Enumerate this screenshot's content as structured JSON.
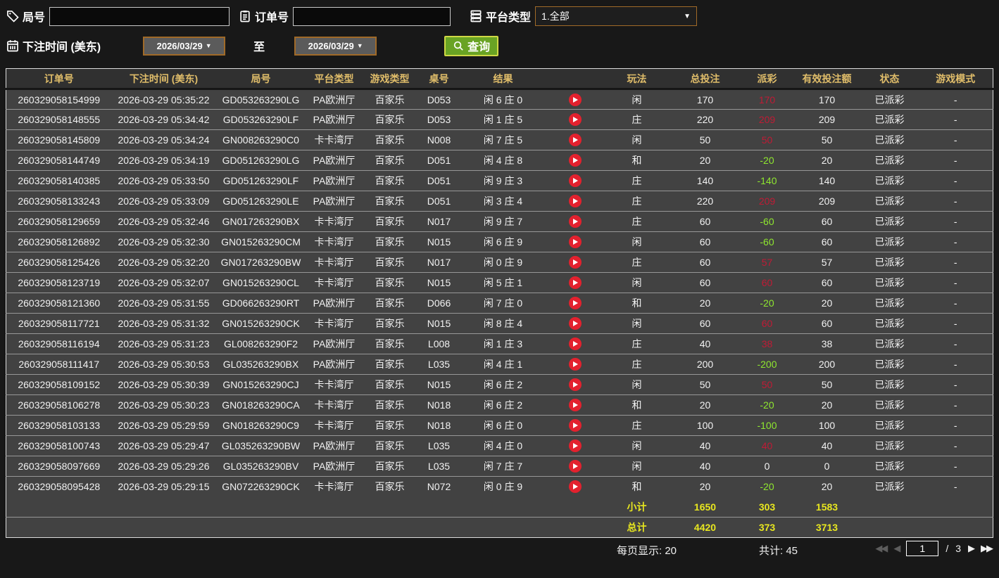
{
  "colors": {
    "header_gold": "#e0bd6a",
    "payout_positive_red": "#c01b35",
    "payout_negative_green": "#8fe72f",
    "status_green": "#35d13f",
    "summary_yellow": "#e8e71f",
    "search_button_green": "#69a324",
    "search_button_border": "#cfd945",
    "date_border_orange": "#a06a28",
    "row_bg": "#424242",
    "play_button_red": "#e3212e"
  },
  "icons": {
    "dropdown": "▼",
    "first_page": "◀◀",
    "prev_page": "◀",
    "next_page": "▶",
    "last_page": "▶▶"
  },
  "filters": {
    "game_no_label": "局号",
    "game_no_value": "",
    "order_no_label": "订单号",
    "order_no_value": "",
    "platform_label": "平台类型",
    "platform_value": "1.全部",
    "bet_time_label": "下注时间 (美东)",
    "date_from": "2026/03/29",
    "to_separator": "至",
    "date_to": "2026/03/29",
    "search_label": "查询"
  },
  "table": {
    "columns": [
      "订单号",
      "下注时间 (美东)",
      "局号",
      "平台类型",
      "游戏类型",
      "桌号",
      "结果",
      "",
      "玩法",
      "总投注",
      "派彩",
      "有效投注额",
      "状态",
      "游戏模式"
    ],
    "rows": [
      {
        "order_no": "260329058154999",
        "bet_time": "2026-03-29 05:35:22",
        "round_no": "GD053263290LG",
        "platform": "PA欧洲厅",
        "game_type": "百家乐",
        "table_no": "D053",
        "result": "闲 6 庄 0",
        "play_type": "闲",
        "total_bet": "170",
        "payout": "170",
        "valid_bet": "170",
        "status": "已派彩",
        "mode": "-"
      },
      {
        "order_no": "260329058148555",
        "bet_time": "2026-03-29 05:34:42",
        "round_no": "GD053263290LF",
        "platform": "PA欧洲厅",
        "game_type": "百家乐",
        "table_no": "D053",
        "result": "闲 1 庄 5",
        "play_type": "庄",
        "total_bet": "220",
        "payout": "209",
        "valid_bet": "209",
        "status": "已派彩",
        "mode": "-"
      },
      {
        "order_no": "260329058145809",
        "bet_time": "2026-03-29 05:34:24",
        "round_no": "GN008263290C0",
        "platform": "卡卡湾厅",
        "game_type": "百家乐",
        "table_no": "N008",
        "result": "闲 7 庄 5",
        "play_type": "闲",
        "total_bet": "50",
        "payout": "50",
        "valid_bet": "50",
        "status": "已派彩",
        "mode": "-"
      },
      {
        "order_no": "260329058144749",
        "bet_time": "2026-03-29 05:34:19",
        "round_no": "GD051263290LG",
        "platform": "PA欧洲厅",
        "game_type": "百家乐",
        "table_no": "D051",
        "result": "闲 4 庄 8",
        "play_type": "和",
        "total_bet": "20",
        "payout": "-20",
        "valid_bet": "20",
        "status": "已派彩",
        "mode": "-"
      },
      {
        "order_no": "260329058140385",
        "bet_time": "2026-03-29 05:33:50",
        "round_no": "GD051263290LF",
        "platform": "PA欧洲厅",
        "game_type": "百家乐",
        "table_no": "D051",
        "result": "闲 9 庄 3",
        "play_type": "庄",
        "total_bet": "140",
        "payout": "-140",
        "valid_bet": "140",
        "status": "已派彩",
        "mode": "-"
      },
      {
        "order_no": "260329058133243",
        "bet_time": "2026-03-29 05:33:09",
        "round_no": "GD051263290LE",
        "platform": "PA欧洲厅",
        "game_type": "百家乐",
        "table_no": "D051",
        "result": "闲 3 庄 4",
        "play_type": "庄",
        "total_bet": "220",
        "payout": "209",
        "valid_bet": "209",
        "status": "已派彩",
        "mode": "-"
      },
      {
        "order_no": "260329058129659",
        "bet_time": "2026-03-29 05:32:46",
        "round_no": "GN017263290BX",
        "platform": "卡卡湾厅",
        "game_type": "百家乐",
        "table_no": "N017",
        "result": "闲 9 庄 7",
        "play_type": "庄",
        "total_bet": "60",
        "payout": "-60",
        "valid_bet": "60",
        "status": "已派彩",
        "mode": "-"
      },
      {
        "order_no": "260329058126892",
        "bet_time": "2026-03-29 05:32:30",
        "round_no": "GN015263290CM",
        "platform": "卡卡湾厅",
        "game_type": "百家乐",
        "table_no": "N015",
        "result": "闲 6 庄 9",
        "play_type": "闲",
        "total_bet": "60",
        "payout": "-60",
        "valid_bet": "60",
        "status": "已派彩",
        "mode": "-"
      },
      {
        "order_no": "260329058125426",
        "bet_time": "2026-03-29 05:32:20",
        "round_no": "GN017263290BW",
        "platform": "卡卡湾厅",
        "game_type": "百家乐",
        "table_no": "N017",
        "result": "闲 0 庄 9",
        "play_type": "庄",
        "total_bet": "60",
        "payout": "57",
        "valid_bet": "57",
        "status": "已派彩",
        "mode": "-"
      },
      {
        "order_no": "260329058123719",
        "bet_time": "2026-03-29 05:32:07",
        "round_no": "GN015263290CL",
        "platform": "卡卡湾厅",
        "game_type": "百家乐",
        "table_no": "N015",
        "result": "闲 5 庄 1",
        "play_type": "闲",
        "total_bet": "60",
        "payout": "60",
        "valid_bet": "60",
        "status": "已派彩",
        "mode": "-"
      },
      {
        "order_no": "260329058121360",
        "bet_time": "2026-03-29 05:31:55",
        "round_no": "GD066263290RT",
        "platform": "PA欧洲厅",
        "game_type": "百家乐",
        "table_no": "D066",
        "result": "闲 7 庄 0",
        "play_type": "和",
        "total_bet": "20",
        "payout": "-20",
        "valid_bet": "20",
        "status": "已派彩",
        "mode": "-"
      },
      {
        "order_no": "260329058117721",
        "bet_time": "2026-03-29 05:31:32",
        "round_no": "GN015263290CK",
        "platform": "卡卡湾厅",
        "game_type": "百家乐",
        "table_no": "N015",
        "result": "闲 8 庄 4",
        "play_type": "闲",
        "total_bet": "60",
        "payout": "60",
        "valid_bet": "60",
        "status": "已派彩",
        "mode": "-"
      },
      {
        "order_no": "260329058116194",
        "bet_time": "2026-03-29 05:31:23",
        "round_no": "GL008263290F2",
        "platform": "PA欧洲厅",
        "game_type": "百家乐",
        "table_no": "L008",
        "result": "闲 1 庄 3",
        "play_type": "庄",
        "total_bet": "40",
        "payout": "38",
        "valid_bet": "38",
        "status": "已派彩",
        "mode": "-"
      },
      {
        "order_no": "260329058111417",
        "bet_time": "2026-03-29 05:30:53",
        "round_no": "GL035263290BX",
        "platform": "PA欧洲厅",
        "game_type": "百家乐",
        "table_no": "L035",
        "result": "闲 4 庄 1",
        "play_type": "庄",
        "total_bet": "200",
        "payout": "-200",
        "valid_bet": "200",
        "status": "已派彩",
        "mode": "-"
      },
      {
        "order_no": "260329058109152",
        "bet_time": "2026-03-29 05:30:39",
        "round_no": "GN015263290CJ",
        "platform": "卡卡湾厅",
        "game_type": "百家乐",
        "table_no": "N015",
        "result": "闲 6 庄 2",
        "play_type": "闲",
        "total_bet": "50",
        "payout": "50",
        "valid_bet": "50",
        "status": "已派彩",
        "mode": "-"
      },
      {
        "order_no": "260329058106278",
        "bet_time": "2026-03-29 05:30:23",
        "round_no": "GN018263290CA",
        "platform": "卡卡湾厅",
        "game_type": "百家乐",
        "table_no": "N018",
        "result": "闲 6 庄 2",
        "play_type": "和",
        "total_bet": "20",
        "payout": "-20",
        "valid_bet": "20",
        "status": "已派彩",
        "mode": "-"
      },
      {
        "order_no": "260329058103133",
        "bet_time": "2026-03-29 05:29:59",
        "round_no": "GN018263290C9",
        "platform": "卡卡湾厅",
        "game_type": "百家乐",
        "table_no": "N018",
        "result": "闲 6 庄 0",
        "play_type": "庄",
        "total_bet": "100",
        "payout": "-100",
        "valid_bet": "100",
        "status": "已派彩",
        "mode": "-"
      },
      {
        "order_no": "260329058100743",
        "bet_time": "2026-03-29 05:29:47",
        "round_no": "GL035263290BW",
        "platform": "PA欧洲厅",
        "game_type": "百家乐",
        "table_no": "L035",
        "result": "闲 4 庄 0",
        "play_type": "闲",
        "total_bet": "40",
        "payout": "40",
        "valid_bet": "40",
        "status": "已派彩",
        "mode": "-"
      },
      {
        "order_no": "260329058097669",
        "bet_time": "2026-03-29 05:29:26",
        "round_no": "GL035263290BV",
        "platform": "PA欧洲厅",
        "game_type": "百家乐",
        "table_no": "L035",
        "result": "闲 7 庄 7",
        "play_type": "闲",
        "total_bet": "40",
        "payout": "0",
        "valid_bet": "0",
        "status": "已派彩",
        "mode": "-"
      },
      {
        "order_no": "260329058095428",
        "bet_time": "2026-03-29 05:29:15",
        "round_no": "GN072263290CK",
        "platform": "卡卡湾厅",
        "game_type": "百家乐",
        "table_no": "N072",
        "result": "闲 0 庄 9",
        "play_type": "和",
        "total_bet": "20",
        "payout": "-20",
        "valid_bet": "20",
        "status": "已派彩",
        "mode": "-"
      }
    ],
    "subtotal": {
      "label": "小计",
      "total_bet": "1650",
      "payout": "303",
      "valid_bet": "1583"
    },
    "total": {
      "label": "总计",
      "total_bet": "4420",
      "payout": "373",
      "valid_bet": "3713"
    }
  },
  "footer": {
    "per_page_label": "每页显示: 20",
    "total_count_label": "共计: 45",
    "current_page": "1",
    "page_separator": "/",
    "total_pages": "3"
  }
}
